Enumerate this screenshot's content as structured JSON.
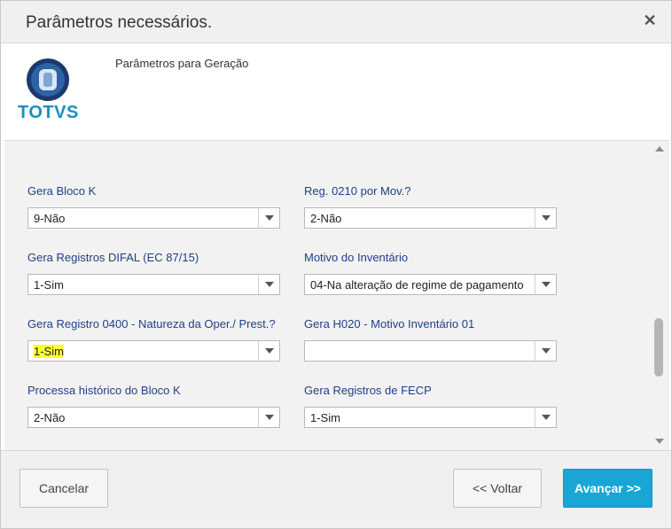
{
  "dialog": {
    "title": "Parâmetros necessários.",
    "close_symbol": "✕"
  },
  "header": {
    "logo_text": "TOTVS",
    "subtitle": "Parâmetros para Geração"
  },
  "fields": [
    {
      "label": "Gera Bloco K",
      "value": "9-Não"
    },
    {
      "label": "Reg. 0210 por Mov.?",
      "value": "2-Não"
    },
    {
      "label": "Gera Registros DIFAL (EC 87/15)",
      "value": "1-Sim"
    },
    {
      "label": "Motivo do Inventário",
      "value": "04-Na alteração de regime de pagamento"
    },
    {
      "label": "Gera Registro 0400 - Natureza da Oper./ Prest.?",
      "value": "1-Sim"
    },
    {
      "label": "Gera H020 - Motivo Inventário 01",
      "value": ""
    },
    {
      "label": "Processa histórico do Bloco K",
      "value": "2-Não"
    },
    {
      "label": "Gera Registros de FECP",
      "value": "1-Sim"
    }
  ],
  "footer": {
    "cancel_first": "C",
    "cancel_rest": "ancelar",
    "back_prefix": "<< ",
    "back_first": "V",
    "back_rest": "oltar",
    "next_first": "A",
    "next_rest": "vançar >>"
  },
  "colors": {
    "label": "#1f3f86",
    "primary_button": "#1aa6d4",
    "highlight": "#ffff33",
    "logo": "#1a8fc1"
  }
}
